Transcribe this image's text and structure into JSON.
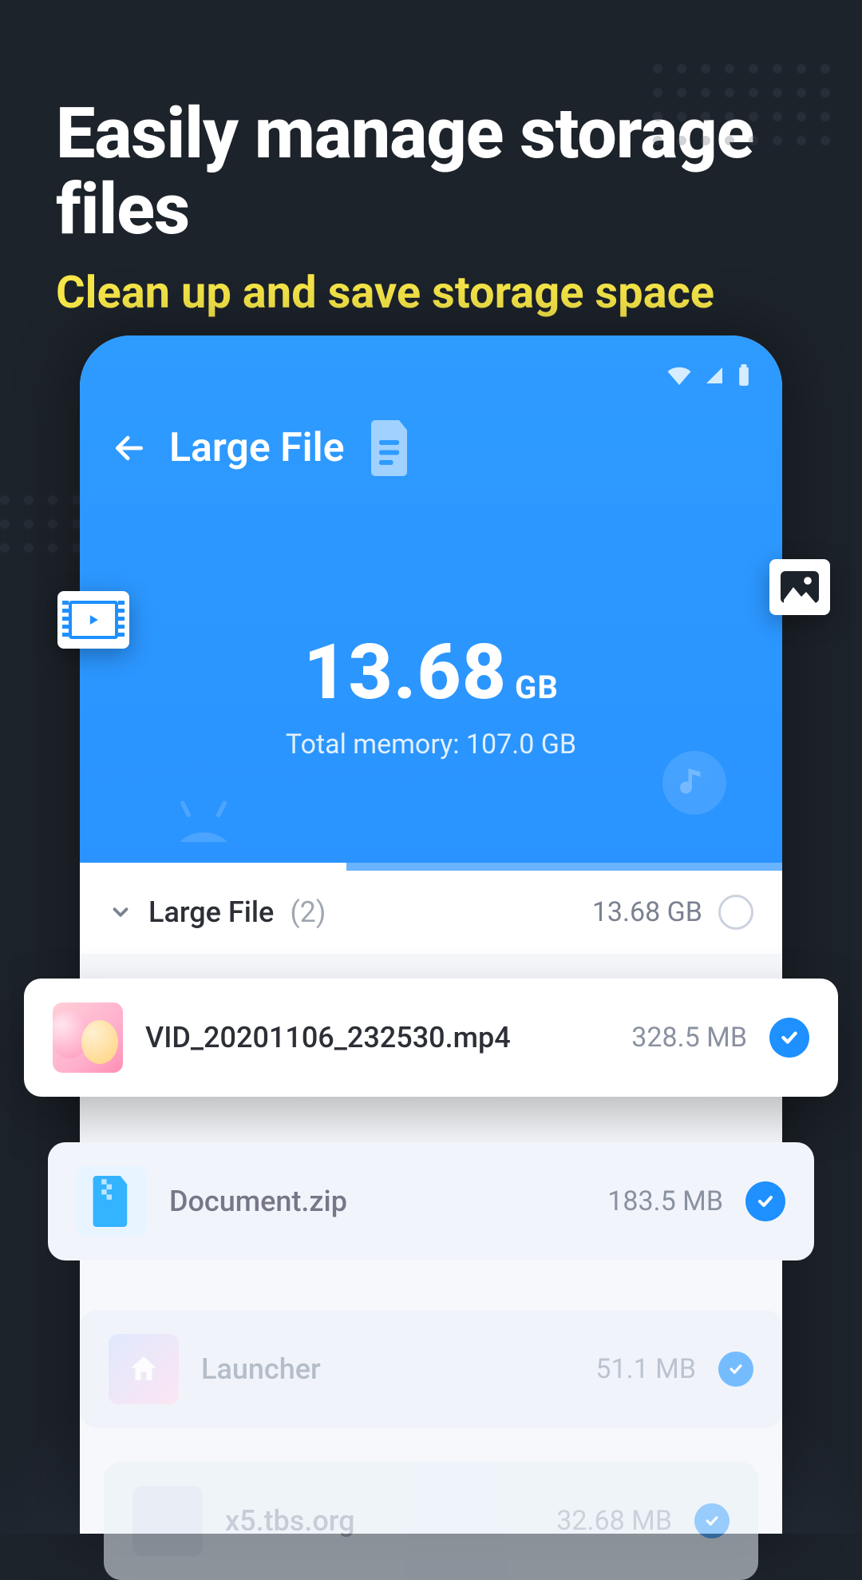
{
  "hero": {
    "title": "Easily manage storage files",
    "subtitle": "Clean up and save storage space"
  },
  "app": {
    "screen_title": "Large File",
    "stat_value": "13.68",
    "stat_unit": "GB",
    "stat_sub": "Total memory: 107.0 GB"
  },
  "section": {
    "label": "Large File",
    "count": "(2)",
    "size": "13.68 GB"
  },
  "files": [
    {
      "name": "VID_20201106_232530.mp4",
      "size": "328.5 MB"
    },
    {
      "name": "Document.zip",
      "size": "183.5 MB"
    },
    {
      "name": "Launcher",
      "size": "51.1 MB"
    },
    {
      "name": "x5.tbs.org",
      "size": "32.68 MB"
    }
  ]
}
